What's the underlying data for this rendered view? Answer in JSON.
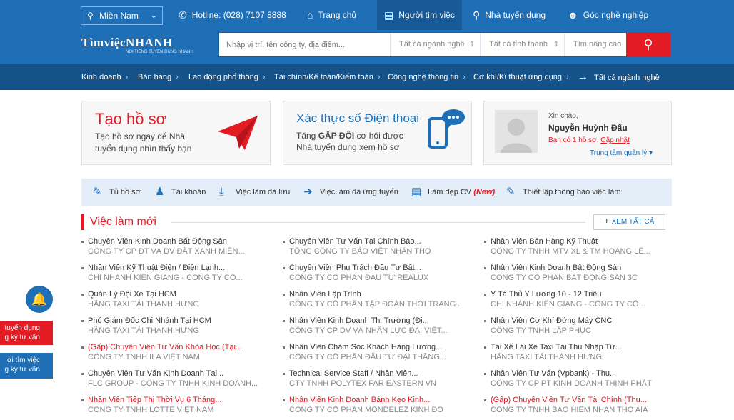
{
  "topbar": {
    "location": "Miền Nam",
    "hotline": "Hotline: (028) 7107 8888",
    "nav": [
      "Trang chủ",
      "Người tìm việc",
      "Nhà tuyển dụng",
      "Góc nghề nghiệp"
    ]
  },
  "logo": {
    "main": "TìmviệcNHANH",
    "sub": "NỐI TIẾNG TUYỂN DỤNG NHANH"
  },
  "search": {
    "placeholder": "Nhập vị trí, tên công ty, địa điểm...",
    "industry": "Tất cả ngành nghề",
    "province": "Tất cả tỉnh thành",
    "skill": "Tìm nâng cao"
  },
  "categories": [
    "Kinh doanh",
    "Bán hàng",
    "Lao động phổ thông",
    "Tài chính/Kế toán/Kiểm toán",
    "Công nghệ thông tin",
    "Cơ khí/Kĩ thuật ứng dụng",
    "Tất cả ngành nghề"
  ],
  "cards": {
    "create": {
      "title": "Tạo hồ sơ",
      "line1": "Tạo hồ sơ ngay để Nhà",
      "line2": "tuyển dụng nhìn thấy bạn"
    },
    "verify": {
      "title": "Xác thực số Điện thoại",
      "line1a": "Tăng",
      "line1b": "GẤP ĐÔI",
      "line1c": "cơ hội được",
      "line2": "Nhà tuyển dụng xem hồ sơ"
    },
    "user": {
      "hello": "Xin chào,",
      "name": "Nguyễn Huỳnh Đấu",
      "profile": "Bạn có 1 hồ sơ.",
      "update": "Cập nhật",
      "manage": "Trung tâm quản lý"
    }
  },
  "shortcuts": [
    "Tủ hồ sơ",
    "Tài khoản",
    "Việc làm đã lưu",
    "Việc làm đã ứng tuyển",
    "Làm đẹp CV",
    "(New)",
    "Thiết lập thông báo việc làm"
  ],
  "section": {
    "title": "Việc làm mới",
    "view_all": "XEM TẤT CẢ"
  },
  "jobs": [
    {
      "title": "Chuyên Viên Kinh Doanh Bất Động Sản",
      "company": "CÔNG TY CP ĐT VÀ DV ĐẤT XANH MIỀN..."
    },
    {
      "title": "Chuyên Viên Tư Vấn Tài Chính Bảo...",
      "company": "TỔNG CÔNG TY BẢO VIỆT NHÂN THỌ"
    },
    {
      "title": "Nhân Viên Bán Hàng Kỹ Thuật",
      "company": "CÔNG TY TNHH MTV XL & TM HOÀNG LÊ..."
    },
    {
      "title": "Nhân Viên Kỹ Thuật Điện / Điện Lạnh...",
      "company": "CHI NHÁNH KIÊN GIANG - CÔNG TY CỔ..."
    },
    {
      "title": "Chuyên Viên Phụ Trách Đầu Tư Bất...",
      "company": "CÔNG TY CỔ PHẦN ĐẦU TƯ REALUX"
    },
    {
      "title": "Nhân Viên Kinh Doanh Bất Động Sản",
      "company": "CÔNG TY CỔ PHẦN BẤT ĐỘNG SẢN 3C"
    },
    {
      "title": "Quản Lý Đội Xe Tại HCM",
      "company": "HÃNG TAXI TẢI THÀNH HƯNG"
    },
    {
      "title": "Nhân Viên Lập Trình",
      "company": "CÔNG TY CỔ PHẦN TẬP ĐOÀN THỜI TRANG..."
    },
    {
      "title": "Y Tá Thủ Y Lương 10 - 12 Triệu",
      "company": "CHI NHÁNH KIÊN GIANG - CÔNG TY CỔ..."
    },
    {
      "title": "Phó Giám Đốc Chi Nhánh Tại HCM",
      "company": "HÃNG TAXI TẢI THÀNH HƯNG"
    },
    {
      "title": "Nhân Viên Kinh Doanh Thị Trường (Đi...",
      "company": "CÔNG TY CP DV VÀ NHÂN LỰC ĐẠI VIỆT..."
    },
    {
      "title": "Nhân Viên Cơ Khí Đứng Máy CNC",
      "company": "CÔNG TY TNHH LẬP PHÚC"
    },
    {
      "title": "(Gấp) Chuyên Viên Tư Vấn Khóa Học (Tại...",
      "company": "CÔNG TY TNHH ILA VIỆT NAM"
    },
    {
      "title": "Nhân Viên Chăm Sóc Khách Hàng Lương...",
      "company": "CÔNG TY CỔ PHẦN ĐẦU TƯ ĐẠI THẮNG..."
    },
    {
      "title": "Tài Xế Lái Xe Taxi Tải Thu Nhập Từ...",
      "company": "HÃNG TAXI TẢI THÀNH HƯNG"
    },
    {
      "title": "Chuyên Viên Tư Vấn Kinh Doanh Tại...",
      "company": "FLC GROUP - CÔNG TY TNHH KINH DOANH..."
    },
    {
      "title": "Technical Service Staff / Nhân Viên...",
      "company": "CTY TNHH POLYTEX FAR EASTERN VN"
    },
    {
      "title": "Nhân Viên Tư Vấn (Vpbank) - Thu...",
      "company": "CÔNG TY CP PT KINH DOANH THỊNH PHÁT"
    },
    {
      "title": "Nhân Viên Tiếp Thị Thời Vụ 6 Tháng...",
      "company": "CÔNG TY TNHH LOTTE VIỆT NAM"
    },
    {
      "title": "Nhân Viên Kinh Doanh Bánh Kẹo Kinh...",
      "company": "CÔNG TY CỔ PHẦN MONDELEZ KINH ĐÔ"
    },
    {
      "title": "(Gấp) Chuyên Viên Tư Vấn Tài Chính (Thu...",
      "company": "CÔNG TY TNHH BẢO HIỂM NHÂN THỌ AIA"
    }
  ],
  "side": {
    "employer_1": "tuyển dụng",
    "employer_2": "g ký tư vấn",
    "seeker_1": "ời tìm việc",
    "seeker_2": "g ký tư vấn"
  },
  "colors": {
    "primary": "#1f6fb7",
    "dark": "#145289",
    "accent": "#e31b23"
  }
}
